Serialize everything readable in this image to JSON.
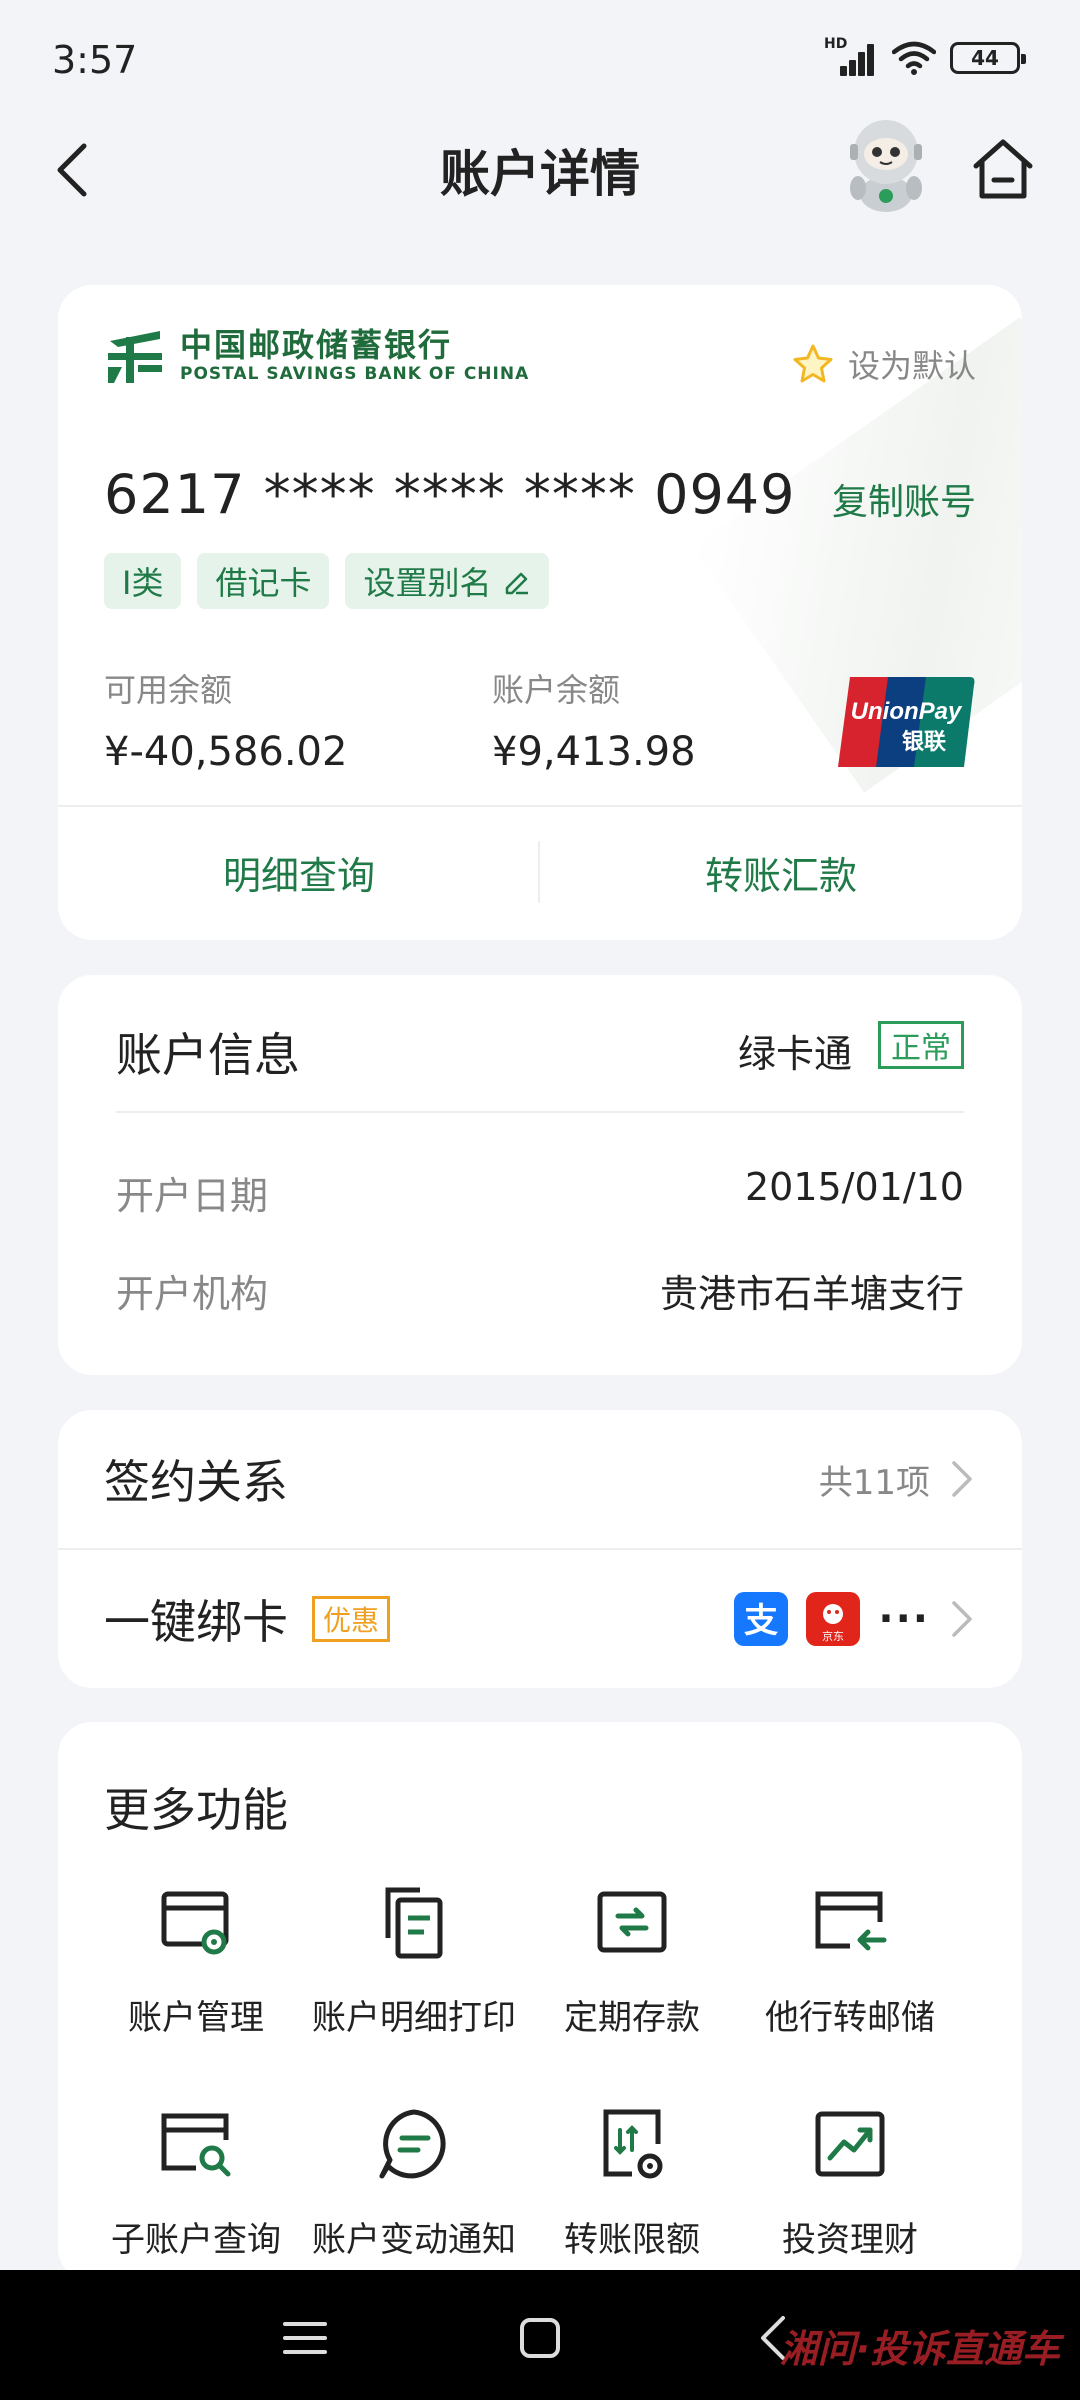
{
  "status_bar": {
    "time": "3:57",
    "network": "HD",
    "battery": "44"
  },
  "header": {
    "title": "账户详情"
  },
  "account_card": {
    "bank_name_cn": "中国邮政储蓄银行",
    "bank_name_en": "POSTAL SAVINGS BANK OF CHINA",
    "set_default": "设为默认",
    "card_number": "6217 **** **** **** 0949",
    "copy_number": "复制账号",
    "tags": [
      "I类",
      "借记卡",
      "设置别名"
    ],
    "available_label": "可用余额",
    "available_value": "¥-40,586.02",
    "balance_label": "账户余额",
    "balance_value": "¥9,413.98",
    "actions": [
      "明细查询",
      "转账汇款"
    ]
  },
  "account_info": {
    "title": "账户信息",
    "product": "绿卡通",
    "status": "正常",
    "rows": [
      {
        "key": "开户日期",
        "value": "2015/01/10"
      },
      {
        "key": "开户机构",
        "value": "贵港市石羊塘支行"
      }
    ]
  },
  "sign_card": {
    "sign_title": "签约关系",
    "sign_count": "共11项",
    "bind_title": "一键绑卡",
    "promo": "优惠",
    "jd_label": "京东",
    "more": "···"
  },
  "more_functions": {
    "title": "更多功能",
    "items": [
      {
        "label": "账户管理",
        "icon": "account-manage-icon"
      },
      {
        "label": "账户明细打印",
        "icon": "statement-print-icon"
      },
      {
        "label": "定期存款",
        "icon": "fixed-deposit-icon"
      },
      {
        "label": "他行转邮储",
        "icon": "transfer-in-icon"
      },
      {
        "label": "子账户查询",
        "icon": "sub-account-search-icon"
      },
      {
        "label": "账户变动通知",
        "icon": "change-notice-icon"
      },
      {
        "label": "转账限额",
        "icon": "transfer-limit-icon"
      },
      {
        "label": "投资理财",
        "icon": "investment-icon"
      }
    ]
  },
  "nav_bar": {
    "watermark": "湘问·投诉直通车"
  },
  "colors": {
    "brand_green": "#1f7a47",
    "badge_green": "#2c9c5a",
    "promo_orange": "#f0a020"
  }
}
